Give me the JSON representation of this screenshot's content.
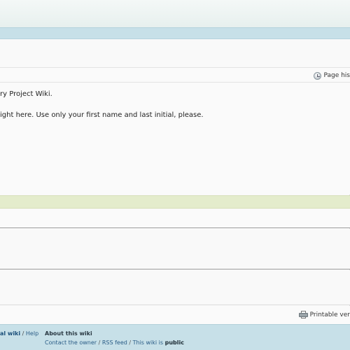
{
  "toolbar": {
    "page_history_label": "Page his"
  },
  "content": {
    "line1": "ry Project Wiki.",
    "line2": "ight here. Use only your first name and last initial, please."
  },
  "print": {
    "printable_label": "Printable ver"
  },
  "footer": {
    "nav_wiki_label": "al wiki",
    "nav_sep": " / ",
    "nav_help_label": "Help",
    "about_title": "About this wiki",
    "contact_owner": "Contact the owner",
    "sep": " / ",
    "rss_feed": "RSS feed",
    "this_wiki_is": "This wiki is ",
    "public": "public"
  }
}
